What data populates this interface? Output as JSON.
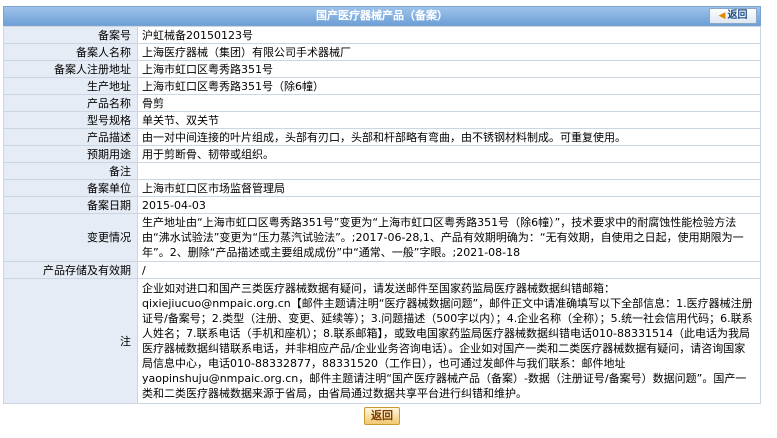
{
  "header": {
    "title": "国产医疗器械产品（备案）",
    "back_label": "返回"
  },
  "rows": [
    {
      "label": "备案号",
      "value": "沪虹械备20150123号"
    },
    {
      "label": "备案人名称",
      "value": "上海医疗器械（集团）有限公司手术器械厂"
    },
    {
      "label": "备案人注册地址",
      "value": "上海市虹口区粤秀路351号"
    },
    {
      "label": "生产地址",
      "value": "上海市虹口区粤秀路351号（除6幢）"
    },
    {
      "label": "产品名称",
      "value": "骨剪"
    },
    {
      "label": "型号规格",
      "value": "单关节、双关节"
    },
    {
      "label": "产品描述",
      "value": "由一对中间连接的叶片组成，头部有刃口，头部和杆部略有弯曲，由不锈钢材料制成。可重复使用。"
    },
    {
      "label": "预期用途",
      "value": "用于剪断骨、韧带或组织。"
    },
    {
      "label": "备注",
      "value": ""
    },
    {
      "label": "备案单位",
      "value": "上海市虹口区市场监督管理局"
    },
    {
      "label": "备案日期",
      "value": "2015-04-03"
    },
    {
      "label": "变更情况",
      "value": "生产地址由“上海市虹口区粤秀路351号”变更为“上海市虹口区粤秀路351号（除6幢）”，技术要求中的耐腐蚀性能检验方法由“沸水试验法”变更为“压力蒸汽试验法”。;2017-06-28,1、产品有效期明确为：“无有效期，自使用之日起，使用期限为一年”。2、删除“产品描述或主要组成成份”中“通常、一般”字眼。;2021-08-18"
    },
    {
      "label": "产品存储及有效期",
      "value": "/"
    }
  ],
  "note": {
    "label": "注",
    "text": "企业如对进口和国产三类医疗器械数据有疑问，请发送邮件至国家药监局医疗器械数据纠错邮箱：qixiejiucuo@nmpaic.org.cn【邮件主题请注明“医疗器械数据问题”，邮件正文中请准确填写以下全部信息：1.医疗器械注册证号/备案号；2.类型（注册、变更、延续等）；3.问题描述（500字以内）；4.企业名称（全称）；5.统一社会信用代码；6.联系人姓名；7.联系电话（手机和座机）；8.联系邮箱】，或致电国家药监局医疗器械数据纠错电话010-88331514（此电话为我局医疗器械数据纠错联系电话，并非相应产品/企业业务咨询电话）。企业如对国产一类和二类医疗器械数据有疑问，请咨询国家局信息中心，电话010-88332877，88331520（工作日），也可通过发邮件与我们联系：邮件地址yaopinshuju@nmpaic.org.cn，邮件主题请注明“国产医疗器械产品（备案）-数据（注册证号/备案号）数据问题”。国产一类和二类医疗器械数据来源于省局，由省局通过数据共享平台进行纠错和维护。"
  },
  "footer": {
    "back_label": "返回"
  }
}
